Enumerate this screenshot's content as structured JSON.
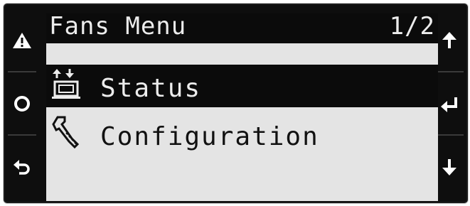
{
  "screen": {
    "title": "Fans Menu",
    "page_indicator": "1/2"
  },
  "menu": {
    "items": [
      {
        "label": "Status",
        "icon": "status-icon",
        "selected": true
      },
      {
        "label": "Configuration",
        "icon": "wrench-icon",
        "selected": false
      }
    ]
  },
  "keys": {
    "left": [
      "alarm-key",
      "program-key",
      "escape-key"
    ],
    "right": [
      "up-key",
      "enter-key",
      "down-key"
    ]
  },
  "colors": {
    "lcd_background": "#e4e4e4",
    "inverse": "#0b0b0b",
    "bezel": "#0e0e0e"
  }
}
